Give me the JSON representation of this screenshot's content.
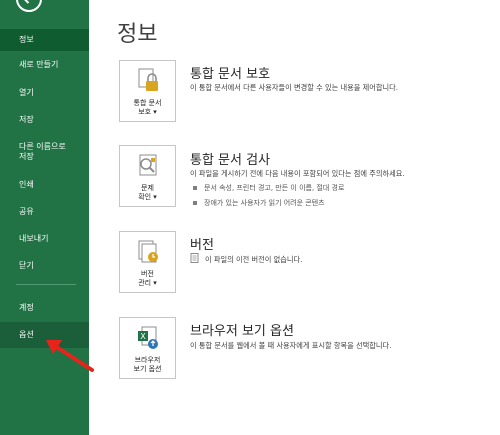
{
  "sidebar": {
    "items": [
      {
        "label": "정보",
        "active": true
      },
      {
        "label": "새로 만들기"
      },
      {
        "label": "열기"
      },
      {
        "label": "저장"
      },
      {
        "label": "다른 이름으로\n저장"
      },
      {
        "label": "인쇄"
      },
      {
        "label": "공유"
      },
      {
        "label": "내보내기"
      },
      {
        "label": "닫기"
      },
      {
        "label": "계정"
      },
      {
        "label": "옵션"
      }
    ],
    "colors": {
      "background": "#217346",
      "active": "#0e5c2f"
    }
  },
  "main": {
    "title": "정보",
    "sections": [
      {
        "tile_label": "통합 문서\n보호 ▾",
        "tile_icon": "lock-icon",
        "title": "통합 문서 보호",
        "description": "이 통합 문서에서 다른 사용자들이 변경할 수 있는 내용을 제어합니다."
      },
      {
        "tile_label": "문제\n확인 ▾",
        "tile_icon": "inspect-document-icon",
        "title": "통합 문서 검사",
        "description": "이 파일을 게시하기 전에 다음 내용이 포함되어 있다는 점에 주의하세요.",
        "bullets": [
          "문서 속성, 프린터 경고, 만든 이 이름, 절대 경로",
          "장애가 있는 사용자가 읽기 어려운 콘텐츠"
        ]
      },
      {
        "tile_label": "버전\n관리 ▾",
        "tile_icon": "versions-icon",
        "title": "버전",
        "description": "이 파일의 이전 버전이 없습니다."
      },
      {
        "tile_label": "브라우저\n보기 옵션",
        "tile_icon": "browser-view-icon",
        "title": "브라우저 보기 옵션",
        "description": "이 통합 문서를 웹에서 볼 때 사용자에게 표시할 항목을 선택합니다."
      }
    ]
  },
  "annotation": {
    "arrow_color": "#e8231c"
  }
}
